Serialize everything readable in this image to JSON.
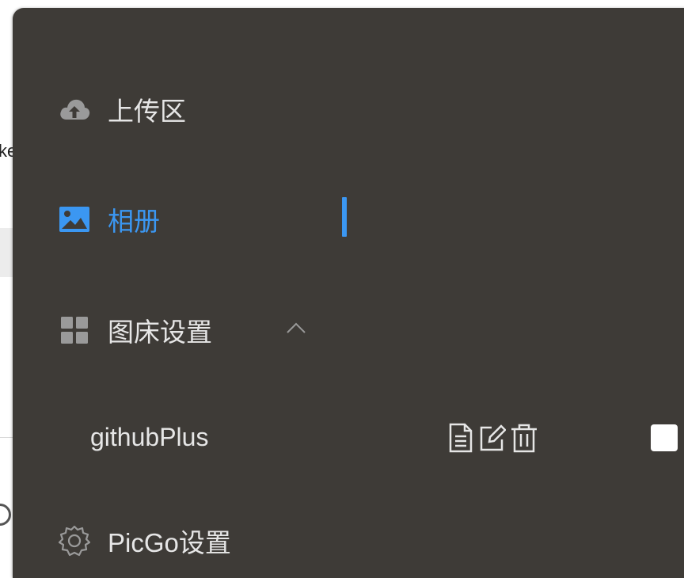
{
  "background": {
    "fragment_text": "ke"
  },
  "menu": {
    "items": [
      {
        "label": "上传区",
        "icon": "cloud-upload-icon",
        "active": false
      },
      {
        "label": "相册",
        "icon": "image-icon",
        "active": true
      },
      {
        "label": "图床设置",
        "icon": "grid-icon",
        "active": false,
        "expanded": true
      },
      {
        "label": "PicGo设置",
        "icon": "gear-icon",
        "active": false
      }
    ],
    "submenu": {
      "label": "githubPlus",
      "actions": [
        "document-icon",
        "edit-icon",
        "trash-icon"
      ],
      "checkbox_checked": false
    }
  },
  "colors": {
    "menu_bg": "#3e3b37",
    "text": "#e6e6e6",
    "accent": "#3b97f2",
    "icon_gray": "#9a9a9a"
  }
}
